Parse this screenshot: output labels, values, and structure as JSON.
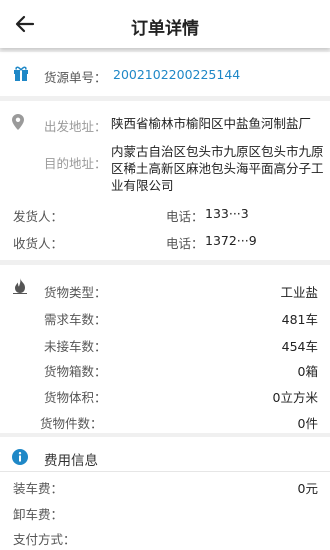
{
  "header": {
    "title": "订单详情"
  },
  "order": {
    "label": "货源单号：",
    "value": "2002102200225144"
  },
  "address": {
    "from_label": "出发地址：",
    "from_value": "陕西省榆林市榆阳区中盐鱼河制盐厂",
    "to_label": "目的地址：",
    "to_value": "内蒙古自治区包头市九原区包头市九原区稀土高新区麻池包头海平面高分子工业有限公司"
  },
  "people": {
    "shipper_label": "发货人：",
    "shipper_name": "",
    "shipper_phone_label": "电话：",
    "shipper_phone": "133···3",
    "receiver_label": "收货人：",
    "receiver_name": "",
    "receiver_phone_label": "电话：",
    "receiver_phone": "1372···9"
  },
  "cargo": {
    "type_label": "货物类型：",
    "type_value": "工业盐",
    "need_label": "需求车数：",
    "need_value": "481车",
    "pending_label": "未接车数：",
    "pending_value": "454车",
    "boxes_label": "货物箱数：",
    "boxes_value": "0箱",
    "volume_label": "货物体积：",
    "volume_value": "0立方米",
    "pieces_label": "货物件数：",
    "pieces_value": "0件"
  },
  "fee": {
    "title": "费用信息",
    "loading_label": "装车费：",
    "loading_value": "0元",
    "unloading_label": "卸车费：",
    "unloading_value": "",
    "payment_label": "支付方式：",
    "payment_value": ""
  },
  "colors": {
    "accent": "#1f88c7",
    "icon_gray": "#9a9a9a",
    "background": "#f0f0f0"
  }
}
